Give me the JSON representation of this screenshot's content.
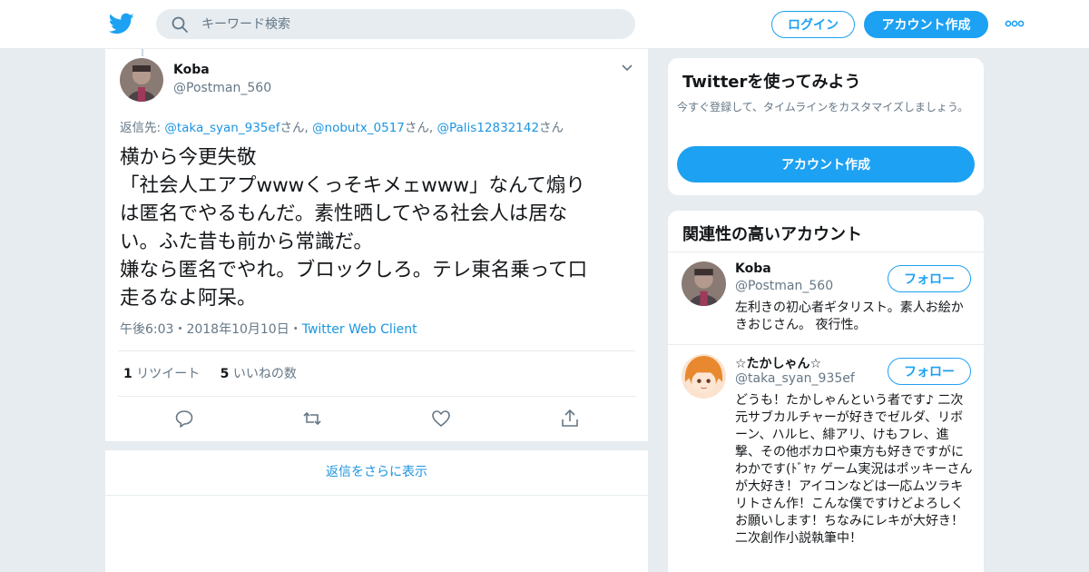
{
  "header": {
    "search_placeholder": "キーワード検索",
    "login_label": "ログイン",
    "signup_label": "アカウント作成"
  },
  "tweet": {
    "author_name": "Koba",
    "author_handle": "@Postman_560",
    "reply_prefix": "返信先: ",
    "reply_mentions": [
      {
        "handle": "@taka_syan_935ef",
        "suffix": "さん, "
      },
      {
        "handle": "@nobutx_0517",
        "suffix": "さん, "
      },
      {
        "handle": "@Palis12832142",
        "suffix": "さん"
      }
    ],
    "text": "横から今更失敬\n「社会人エアプwwwくっそキメェwww」なんて煽り\nは匿名でやるもんだ。素性晒してやる社会人は居な\nい。ふた昔も前から常識だ。\n嫌なら匿名でやれ。ブロックしろ。テレ東名乗って口\n走るなよ阿呆。",
    "time": "午後6:03",
    "date": "2018年10月10日",
    "separator": "・",
    "client": "Twitter Web Client",
    "retweet_count": "1",
    "retweet_label": "リツイート",
    "like_count": "5",
    "like_label": "いいねの数"
  },
  "more_replies_label": "返信をさらに表示",
  "signup_card": {
    "title": "Twitterを使ってみよう",
    "description": "今すぐ登録して、タイムラインをカスタマイズしましょう。",
    "button_label": "アカウント作成"
  },
  "related": {
    "title": "関連性の高いアカウント",
    "follow_label": "フォロー",
    "accounts": [
      {
        "name": "Koba",
        "handle": "@Postman_560",
        "bio": "左利きの初心者ギタリスト。素人お絵かきおじさん。 夜行性。"
      },
      {
        "name": "☆たかしゃん☆",
        "handle": "@taka_syan_935ef",
        "bio": "どうも！たかしゃんという者です♪ 二次元サブカルチャーが好きでゼルダ、リボーン、ハルヒ、緋アリ、けもフレ、進撃、その他ボカロや東方も好きですがにわかです(ﾄﾞﾔｧ ゲーム実況はポッキーさんが大好き！アイコンなどは一応ムツラキリトさん作！こんな僕ですけどよろしくお願いします！ちなみにレキが大好き！二次創作小説執筆中！"
      }
    ]
  },
  "colors": {
    "brand": "#1da1f2",
    "link": "#1b95e0",
    "secondary_text": "#657786",
    "background": "#e6ecf0"
  }
}
